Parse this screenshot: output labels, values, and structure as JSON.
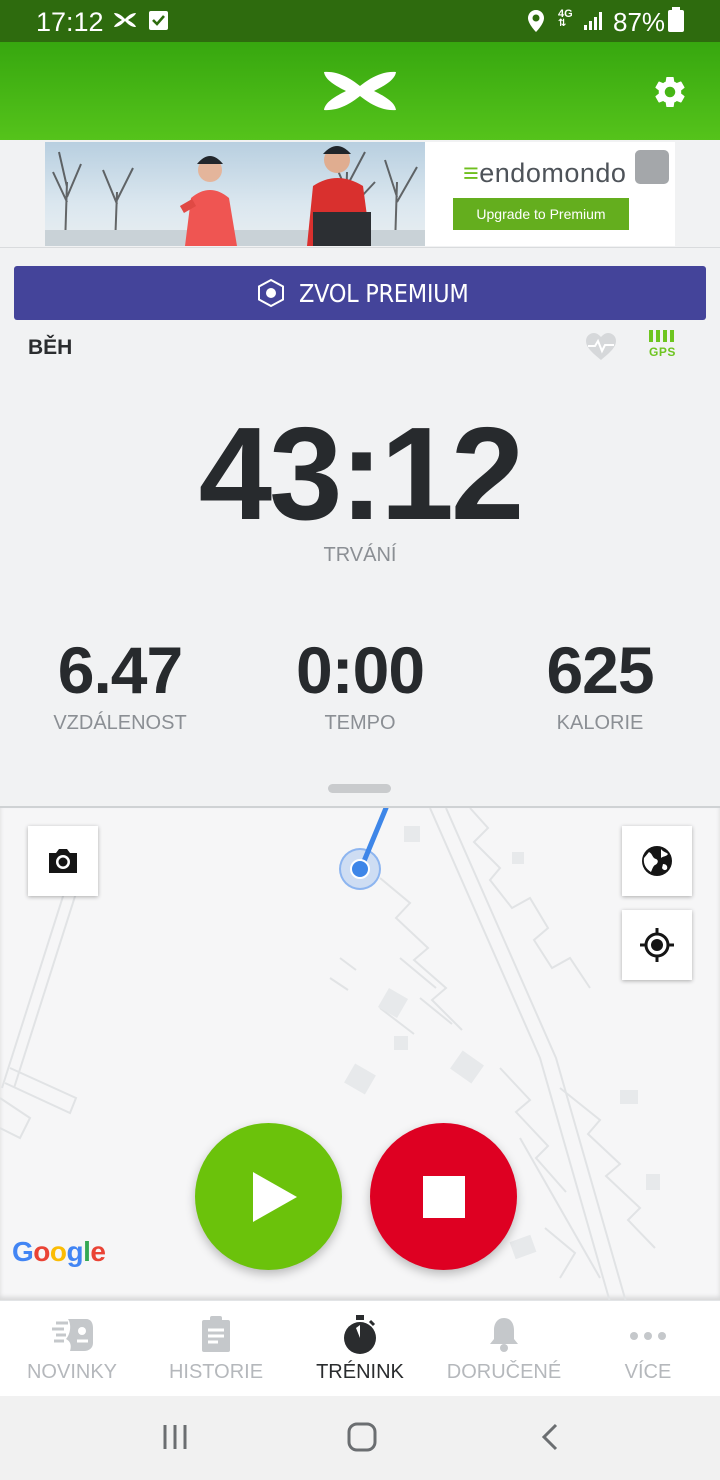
{
  "status_bar": {
    "time": "17:12",
    "network": "4G",
    "battery": "87%"
  },
  "app_bar": {
    "logo": "under-armour-logo",
    "settings_icon": "gear-icon"
  },
  "ad": {
    "brand": "endomondo",
    "cta": "Upgrade to Premium"
  },
  "premium": {
    "label": "ZVOL PREMIUM"
  },
  "workout": {
    "sport": "BĚH",
    "duration": "43:12",
    "duration_label": "TRVÁNÍ",
    "gps_label": "GPS",
    "gps_signal_bars": 4,
    "stats": [
      {
        "value": "6.47",
        "label": "VZDÁLENOST"
      },
      {
        "value": "0:00",
        "label": "TEMPO"
      },
      {
        "value": "625",
        "label": "KALORIE"
      }
    ]
  },
  "map": {
    "attribution": "Google"
  },
  "bottom_nav": {
    "items": [
      {
        "label": "NOVINKY",
        "icon": "endomondo-news-icon",
        "active": false
      },
      {
        "label": "HISTORIE",
        "icon": "clipboard-icon",
        "active": false
      },
      {
        "label": "TRÉNINK",
        "icon": "stopwatch-icon",
        "active": true
      },
      {
        "label": "DORUČENÉ",
        "icon": "bell-icon",
        "active": false
      },
      {
        "label": "VÍCE",
        "icon": "more-dots-icon",
        "active": false
      }
    ]
  },
  "colors": {
    "app_bar": "#37a70f",
    "premium": "#44449a",
    "play": "#6bc20b",
    "stop": "#de0022",
    "route": "#3e86e8"
  }
}
